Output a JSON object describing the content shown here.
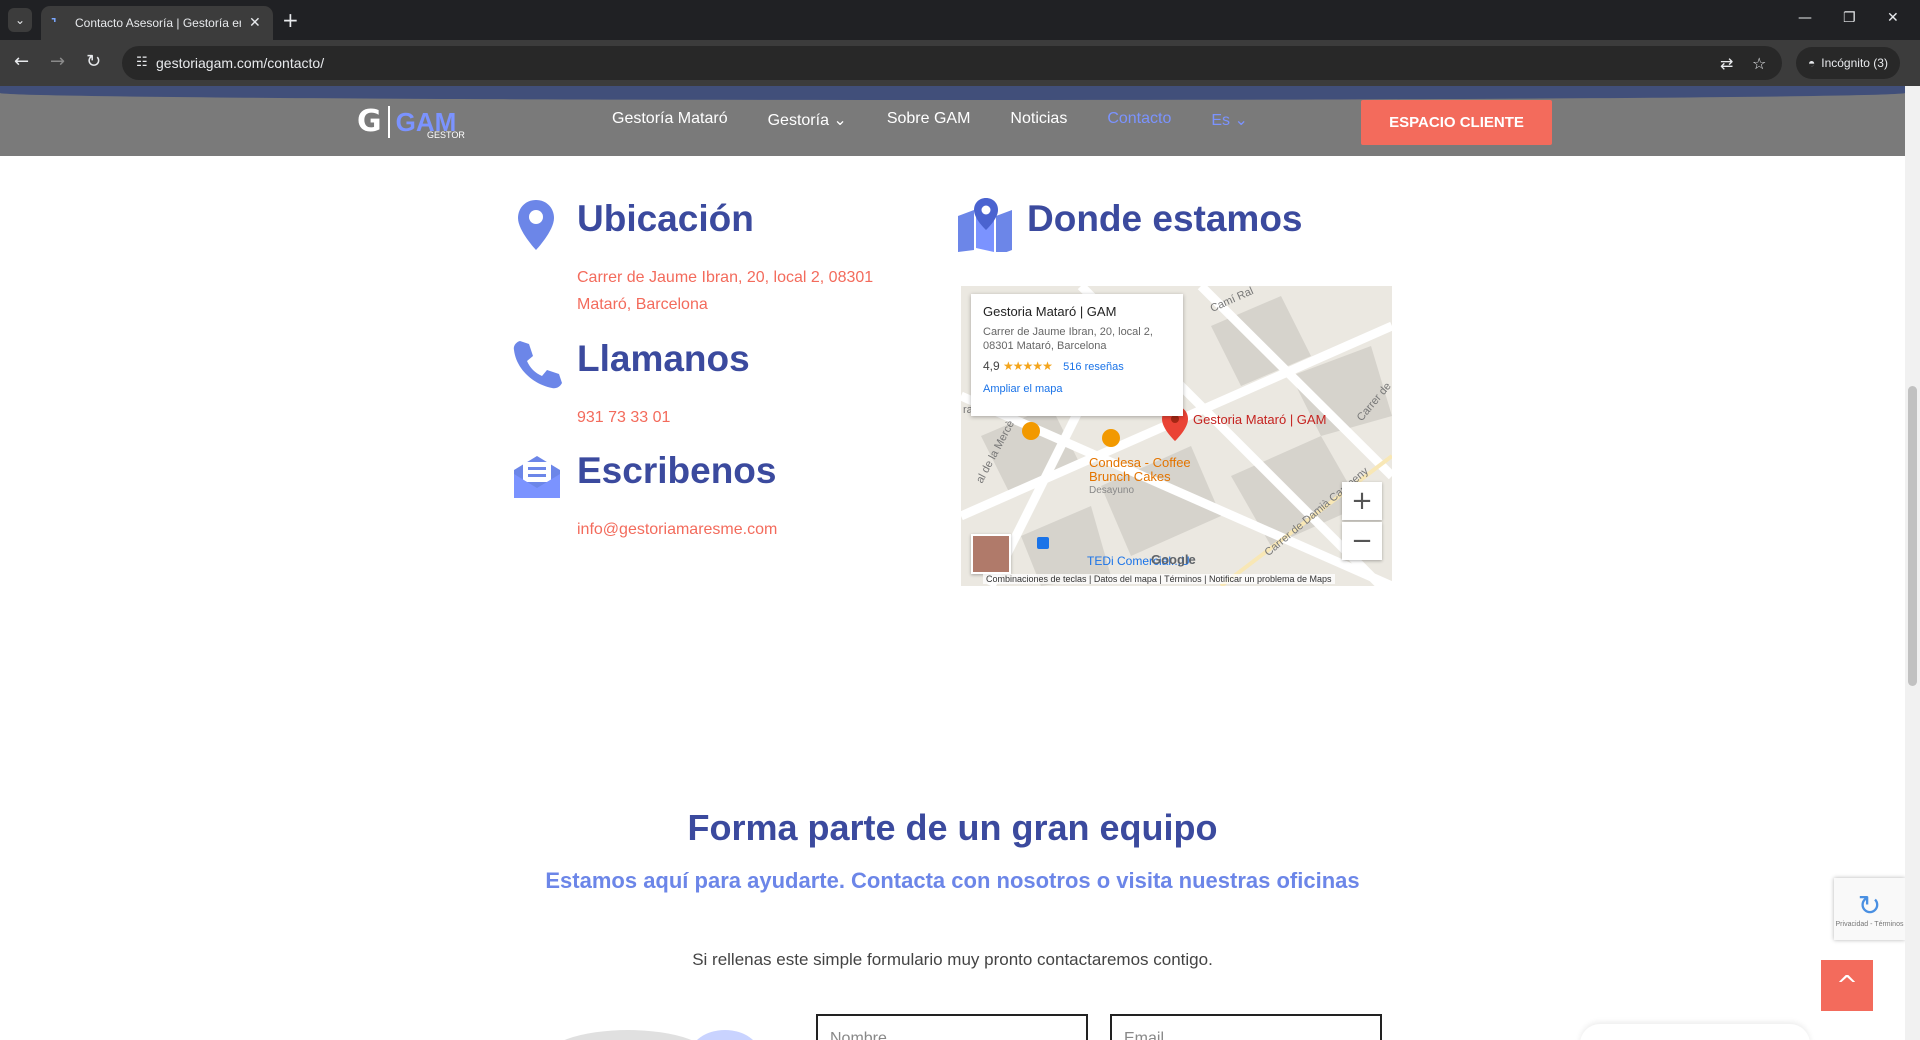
{
  "browser": {
    "tab_title": "Contacto Asesoría | Gestoría en",
    "tab_close": "✕",
    "new_tab": "+",
    "url": "gestoriagam.com/contacto/",
    "incognito_label": "Incógnito (3)",
    "icons": [
      "tab-menu-icon",
      "back-icon",
      "forward-icon",
      "reload-icon",
      "site-info-icon",
      "translate-icon",
      "star-icon",
      "incognito-icon",
      "minimize-icon",
      "maximize-icon",
      "close-icon"
    ]
  },
  "header": {
    "logo_text": "GAM",
    "logo_sub": "GESTOR",
    "menu": [
      {
        "label": "Gestoría Mataró"
      },
      {
        "label": "Gestoría ⌄"
      },
      {
        "label": "Sobre GAM"
      },
      {
        "label": "Noticias"
      },
      {
        "label": "Contacto"
      },
      {
        "label": "Es ⌄"
      }
    ],
    "cta_label": "ESPACIO CLIENTE",
    "colors": {
      "accent": "#f36b5c",
      "brand_blue": "#3b4a9e",
      "brand_light": "#7b93ff"
    }
  },
  "info": {
    "location": {
      "heading": "Ubicación",
      "line1": "Carrer de Jaume Ibran, 20, local 2, 08301",
      "line2": "Mataró, Barcelona",
      "icon": "location-pin-icon"
    },
    "phone": {
      "heading": "Llamanos",
      "text": "931 73 33 01",
      "icon": "phone-icon"
    },
    "email": {
      "heading": "Escribenos",
      "text": "info@gestoriamaresme.com",
      "icon": "mail-icon"
    },
    "map_section": {
      "heading": "Donde estamos",
      "icon": "map-icon"
    }
  },
  "map": {
    "card_title": "Gestoria Mataró | GAM",
    "card_addr1": "Carrer de Jaume Ibran, 20, local 2,",
    "card_addr2": "08301 Mataró, Barcelona",
    "rating": "4,9",
    "stars": "★★★★★",
    "reviews": "516 reseñas",
    "expand_link": "Ampliar el mapa",
    "pin_label": "Gestoria Mataró | GAM",
    "poi_name1": "Condesa - Coffee",
    "poi_name2": "Brunch Cakes",
    "poi_type": "Desayuno",
    "store_label": "TEDi Comercial...U",
    "google": "Google",
    "street1": "Camí Ral",
    "street2": "Carrer de",
    "street3": "Carrer de Damià Campeny",
    "street4": "al de la Mercè",
    "street5": "ra",
    "zoom_in": "+",
    "zoom_out": "−",
    "footer": "Combinaciones de teclas  |  Datos del mapa  |  Términos  |  Notificar un problema de Maps"
  },
  "join": {
    "title": "Forma parte de un gran equipo",
    "subtitle": "Estamos aquí para ayudarte. Contacta con nosotros o visita nuestras oficinas",
    "description": "Si rellenas este simple formulario muy pronto contactaremos contigo.",
    "name_placeholder": "Nombre",
    "email_placeholder": "Email"
  },
  "widgets": {
    "recaptcha_text": "Privacidad - Términos",
    "to_top": "^"
  }
}
